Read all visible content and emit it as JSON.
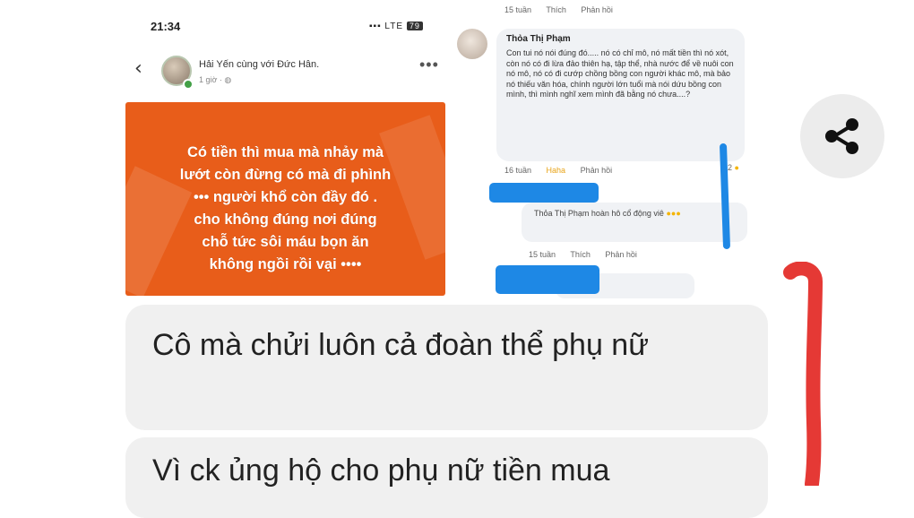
{
  "phone": {
    "status_time": "21:34",
    "status_network": "LTE",
    "status_battery": "79",
    "post_author": "Hải Yến cùng với Đức Hân.",
    "post_time": "1 giờ · ",
    "post_text": "Có tiền thì mua mà nhảy mà\nlướt còn đừng có mà đi phình\n•••   người khổ còn đầy đó .\ncho không đúng nơi đúng\nchỗ  tức sôi máu bọn ăn\nkhông ngồi rồi  vại ••••",
    "post_bg_color": "#e85d1a"
  },
  "top_meta": {
    "time": "15 tuần",
    "like": "Thích",
    "reply": "Phản hồi"
  },
  "comment": {
    "name": "Thỏa Thị Phạm",
    "text": "Con tui nó nói đúng đó..... nó có chỉ mô, nó mất tiền thì nó xót, còn nó có đi lừa đảo thiên hạ, tập thể, nhà nước để về nuôi con nó mô, nó có đi cướp chồng bồng con người khác mô, mà bảo nó thiếu văn hóa, chính người lớn tuổi mà nói dứu bồng con mình, thì mình nghĩ xem mình đã bằng nó chưa....?",
    "time": "16 tuần",
    "reaction": "Haha",
    "reply": "Phản hồi",
    "laugh_count": "2"
  },
  "reply": {
    "text": "Thỏa Thị Phạm hoàn hô cổ động viê",
    "time": "15 tuần",
    "like": "Thích",
    "reply": "Phản hồi"
  },
  "chat": {
    "message_1": "Cô mà chửi luôn cả đoàn thể phụ nữ",
    "message_2": "Vì ck ủng hộ cho phụ nữ tiền mua"
  },
  "colors": {
    "accent_orange": "#e85d1a",
    "redaction_blue": "#1e88e5",
    "annotation_red": "#e53935"
  },
  "icons": {
    "share": "share-icon",
    "back": "chevron-left-icon",
    "more": "more-horizontal-icon"
  }
}
